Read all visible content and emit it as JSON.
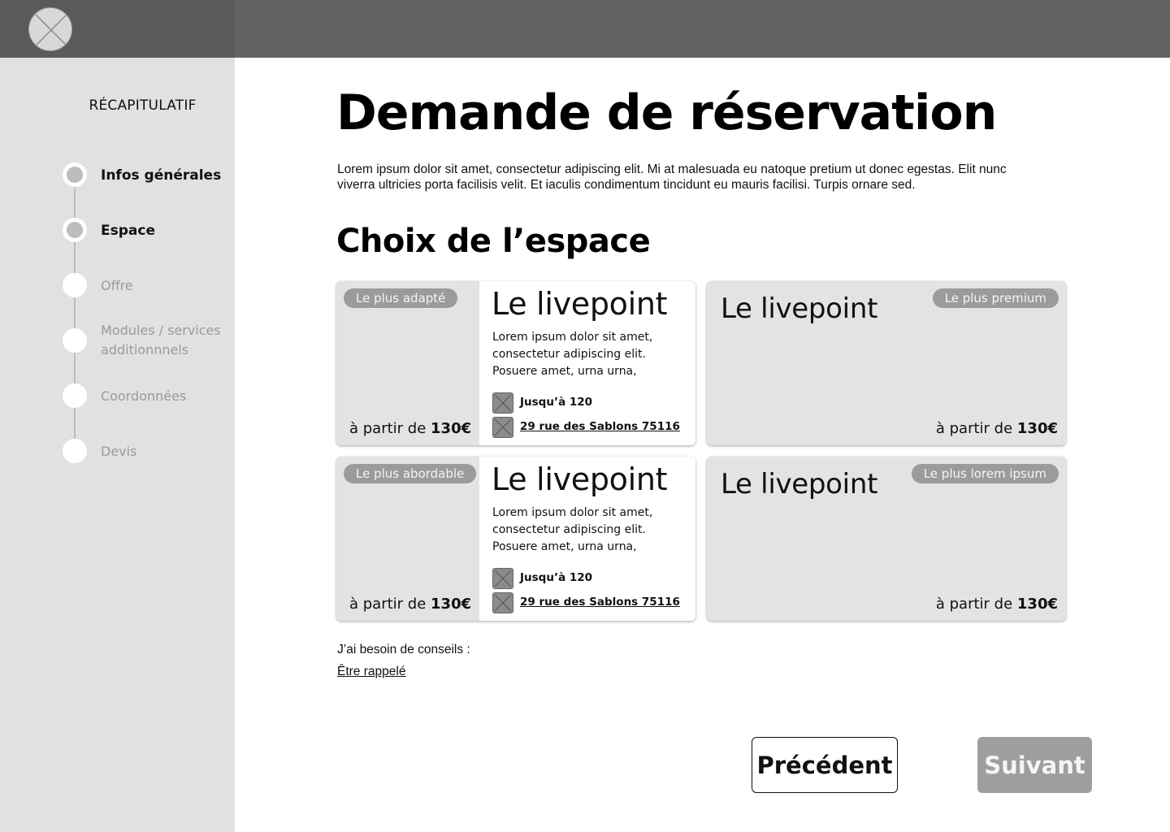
{
  "header": {
    "logo_icon": "placeholder-image-icon"
  },
  "sidebar": {
    "title": "RÉCAPITULATIF",
    "steps": [
      {
        "label": "Infos générales",
        "state": "done"
      },
      {
        "label": "Espace",
        "state": "current"
      },
      {
        "label": "Offre",
        "state": "todo"
      },
      {
        "label": "Modules / services additionnnels",
        "state": "todo"
      },
      {
        "label": "Coordonnées",
        "state": "todo"
      },
      {
        "label": "Devis",
        "state": "todo"
      }
    ]
  },
  "main": {
    "title": "Demande de réservation",
    "intro": "Lorem ipsum dolor sit amet, consectetur adipiscing elit. Mi at malesuada eu natoque pretium ut donec egestas. Elit nunc viverra ultricies porta facilisis velit. Et iaculis condimentum tincidunt eu mauris facilisi. Turpis ornare sed.",
    "section_title": "Choix de l’espace",
    "cards": [
      {
        "badge": "Le plus adapté",
        "name": "Le livepoint",
        "price_prefix": "à partir de ",
        "price": "130€",
        "description": "Lorem ipsum dolor sit amet, consectetur adipiscing elit. Posuere amet, urna urna,",
        "capacity": "Jusqu’à 120",
        "address": "29 rue des Sablons 75116"
      },
      {
        "badge": "Le plus premium",
        "name": "Le livepoint",
        "price_prefix": "à partir de ",
        "price": "130€"
      },
      {
        "badge": "Le plus abordable",
        "name": "Le livepoint",
        "price_prefix": "à partir de ",
        "price": "130€",
        "description": "Lorem ipsum dolor sit amet, consectetur adipiscing elit. Posuere amet, urna urna,",
        "capacity": "Jusqu’à 120",
        "address": "29 rue des Sablons 75116"
      },
      {
        "badge": "Le plus lorem ipsum",
        "name": "Le livepoint",
        "price_prefix": "à partir de ",
        "price": "130€"
      }
    ],
    "help_label": "J’ai besoin de conseils :",
    "help_link": "Être rappelé"
  },
  "actions": {
    "previous_label": "Précédent",
    "next_label": "Suivant"
  },
  "colors": {
    "topbar": "#636363",
    "sidebar": "#e1e1e1",
    "card": "#e3e3e3",
    "badge": "#9b9b9b",
    "next_button": "#9e9e9e"
  }
}
